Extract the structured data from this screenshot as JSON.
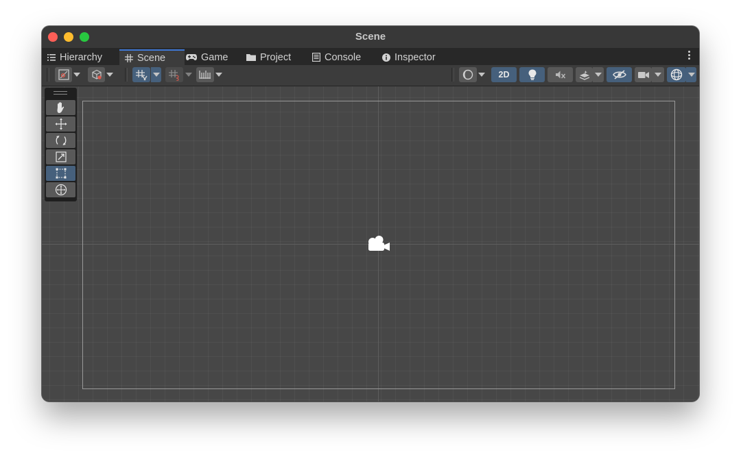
{
  "window": {
    "title": "Scene"
  },
  "tabs": [
    {
      "label": "Hierarchy",
      "icon": "hierarchy-icon",
      "active": false
    },
    {
      "label": "Scene",
      "icon": "grid-hash-icon",
      "active": true
    },
    {
      "label": "Game",
      "icon": "gamepad-icon",
      "active": false
    },
    {
      "label": "Project",
      "icon": "folder-icon",
      "active": false
    },
    {
      "label": "Console",
      "icon": "console-icon",
      "active": false
    },
    {
      "label": "Inspector",
      "icon": "info-icon",
      "active": false
    }
  ],
  "toolbar": {
    "mode_2d_label": "2D",
    "left_buttons": [
      "draw-mode-icon",
      "render-mode-cube-icon",
      "grid-snap-icon",
      "increment-snap-icon",
      "ruler-icon"
    ],
    "right_buttons": [
      "shading-mode-icon",
      "2d-toggle",
      "lighting-icon",
      "audio-mute-icon",
      "effects-icon",
      "hidden-visibility-icon",
      "camera-icon",
      "gizmos-icon"
    ]
  },
  "tools": [
    "hand-tool-icon",
    "move-tool-icon",
    "rotate-tool-icon",
    "scale-tool-icon",
    "rect-tool-icon",
    "transform-tool-icon"
  ],
  "active_tool": "rect-tool-icon",
  "colors": {
    "accent": "#46607c",
    "tab_highlight": "#3f78d6",
    "scene_background": "#474747"
  }
}
